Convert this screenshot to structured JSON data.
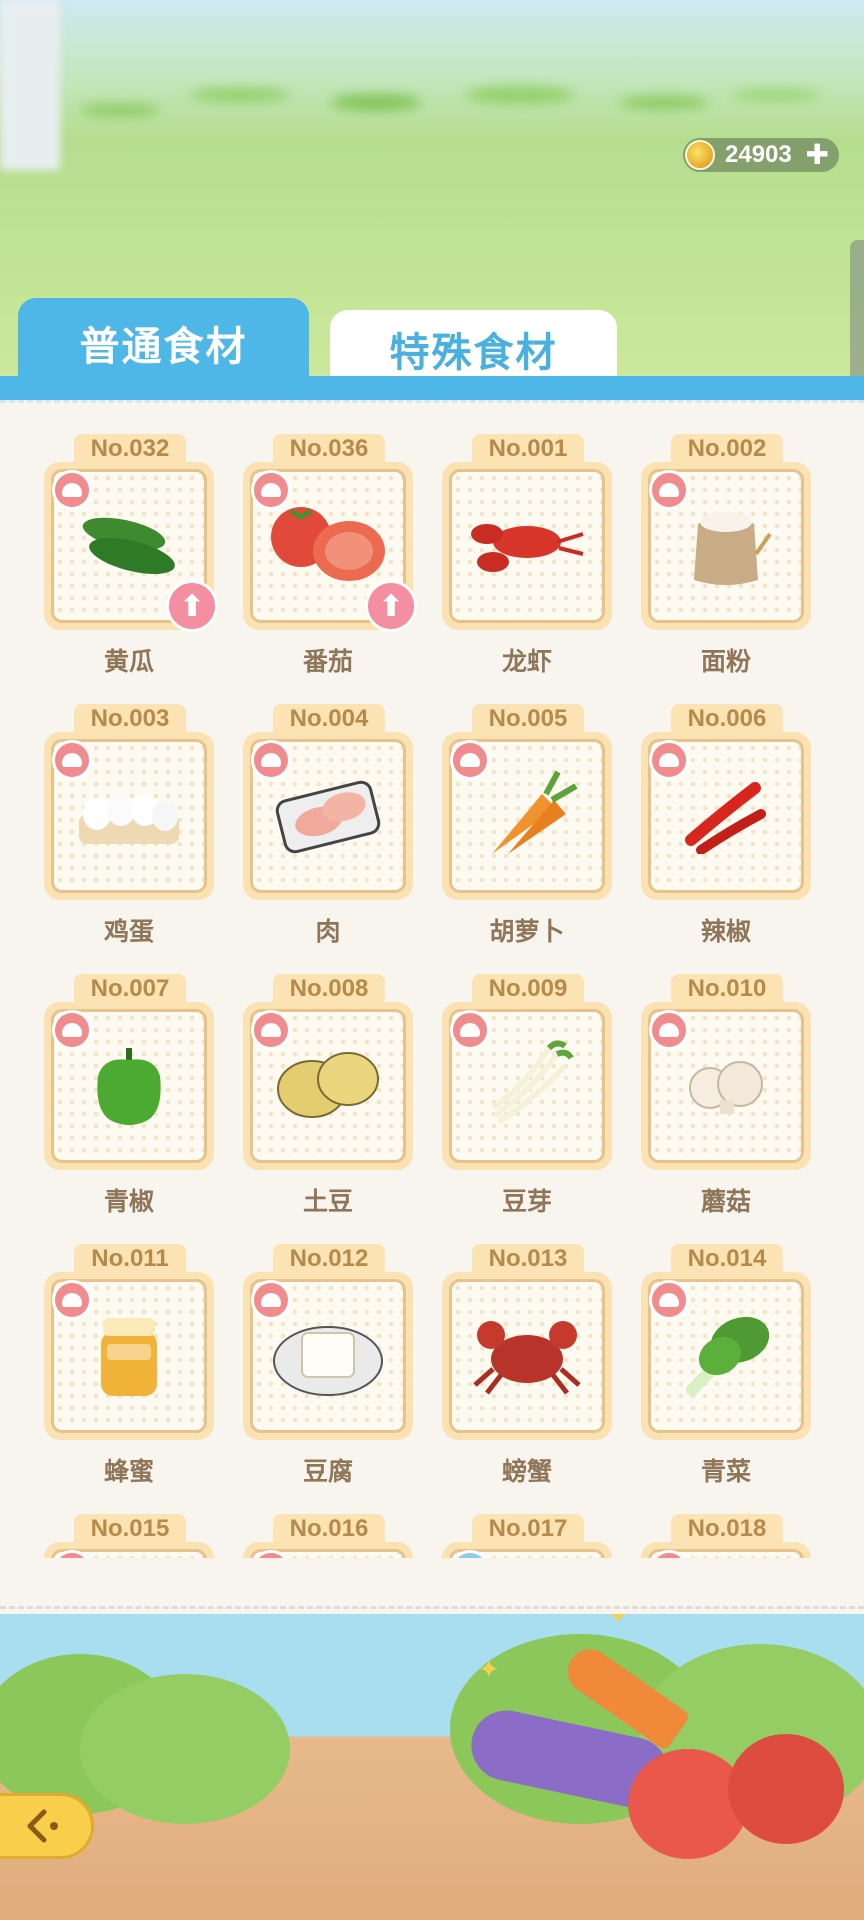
{
  "currency": {
    "amount": "24903",
    "icon": "coin-icon",
    "add_icon": "plus-icon"
  },
  "tabs": [
    {
      "label": "普通食材",
      "active": true
    },
    {
      "label": "特殊食材",
      "active": false
    }
  ],
  "ingredients": [
    {
      "no": "No.032",
      "name": "黄瓜",
      "icon": "cucumber-icon",
      "chef": true,
      "upgrade": true
    },
    {
      "no": "No.036",
      "name": "番茄",
      "icon": "tomato-icon",
      "chef": true,
      "upgrade": true
    },
    {
      "no": "No.001",
      "name": "龙虾",
      "icon": "lobster-icon",
      "chef": false,
      "upgrade": false
    },
    {
      "no": "No.002",
      "name": "面粉",
      "icon": "flour-icon",
      "chef": true,
      "upgrade": false
    },
    {
      "no": "No.003",
      "name": "鸡蛋",
      "icon": "egg-icon",
      "chef": true,
      "upgrade": false
    },
    {
      "no": "No.004",
      "name": "肉",
      "icon": "meat-icon",
      "chef": true,
      "upgrade": false
    },
    {
      "no": "No.005",
      "name": "胡萝卜",
      "icon": "carrot-icon",
      "chef": true,
      "upgrade": false
    },
    {
      "no": "No.006",
      "name": "辣椒",
      "icon": "chili-icon",
      "chef": true,
      "upgrade": false
    },
    {
      "no": "No.007",
      "name": "青椒",
      "icon": "green-pepper-icon",
      "chef": true,
      "upgrade": false
    },
    {
      "no": "No.008",
      "name": "土豆",
      "icon": "potato-icon",
      "chef": true,
      "upgrade": false
    },
    {
      "no": "No.009",
      "name": "豆芽",
      "icon": "bean-sprout-icon",
      "chef": true,
      "upgrade": false
    },
    {
      "no": "No.010",
      "name": "蘑菇",
      "icon": "mushroom-icon",
      "chef": true,
      "upgrade": false
    },
    {
      "no": "No.011",
      "name": "蜂蜜",
      "icon": "honey-icon",
      "chef": true,
      "upgrade": false
    },
    {
      "no": "No.012",
      "name": "豆腐",
      "icon": "tofu-icon",
      "chef": true,
      "upgrade": false
    },
    {
      "no": "No.013",
      "name": "螃蟹",
      "icon": "crab-icon",
      "chef": false,
      "upgrade": false
    },
    {
      "no": "No.014",
      "name": "青菜",
      "icon": "bok-choy-icon",
      "chef": true,
      "upgrade": false
    },
    {
      "no": "No.015",
      "name": "",
      "icon": "",
      "chef": true,
      "upgrade": false
    },
    {
      "no": "No.016",
      "name": "",
      "icon": "",
      "chef": true,
      "upgrade": false
    },
    {
      "no": "No.017",
      "name": "",
      "icon": "",
      "chef": true,
      "chef_color": "blue",
      "upgrade": false
    },
    {
      "no": "No.018",
      "name": "",
      "icon": "",
      "chef": true,
      "upgrade": false
    }
  ],
  "back_button": {
    "icon": "back-arrow-icon"
  },
  "colors": {
    "accent": "#4eb7e7",
    "card": "#fbe2b2",
    "label": "#8f7659"
  }
}
